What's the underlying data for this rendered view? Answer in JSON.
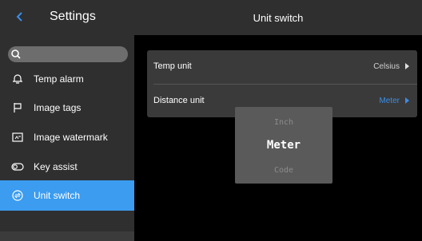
{
  "sidebar": {
    "title": "Settings",
    "items": [
      {
        "label": "Temp alarm",
        "icon": "alarm-icon"
      },
      {
        "label": "Image tags",
        "icon": "flag-icon"
      },
      {
        "label": "Image watermark",
        "icon": "watermark-icon"
      },
      {
        "label": "Key assist",
        "icon": "toggle-icon"
      },
      {
        "label": "Unit switch",
        "icon": "unit-switch-icon",
        "active": true
      }
    ]
  },
  "header": {
    "title": "Unit switch"
  },
  "settings": {
    "rows": [
      {
        "label": "Temp unit",
        "value": "Celsius"
      },
      {
        "label": "Distance unit",
        "value": "Meter"
      }
    ]
  },
  "picker": {
    "options": [
      "Inch",
      "Meter",
      "Code"
    ],
    "selected": "Meter"
  },
  "colors": {
    "accent": "#3b9cf0",
    "background": "#000000",
    "panel": "#2f2f2f",
    "card": "#3a3a3a"
  }
}
